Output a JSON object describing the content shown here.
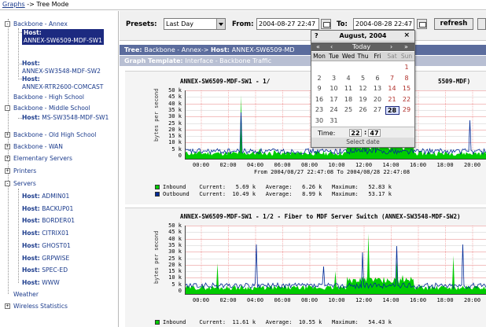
{
  "breadcrumb": {
    "link": "Graphs",
    "sep": " -> ",
    "current": "Tree Mode"
  },
  "tree": {
    "annex": "Backbone - Annex",
    "annex_hosts": [
      {
        "prefix": "Host:",
        "name": "ANNEX-SW6509-MDF-SW1"
      },
      {
        "prefix": "Host:",
        "name": "ANNEX-SW3548-MDF-SW2"
      },
      {
        "prefix": "Host:",
        "name": "ANNEX-RTR2600-COMCAST"
      }
    ],
    "high_school": "Backbone - High School",
    "middle_school": "Backbone - Middle School",
    "middle_host": {
      "prefix": "Host:",
      "name": "MS-SW3548-MDF-SW1"
    },
    "old_high": "Backbone - Old High School",
    "wan": "Backbone - WAN",
    "elementary": "Elementary Servers",
    "printers": "Printers",
    "servers": "Servers",
    "server_hosts": [
      {
        "prefix": "Host:",
        "name": "ADMIN01"
      },
      {
        "prefix": "Host:",
        "name": "BACKUP01"
      },
      {
        "prefix": "Host:",
        "name": "BORDER01"
      },
      {
        "prefix": "Host:",
        "name": "CITRIX01"
      },
      {
        "prefix": "Host:",
        "name": "GHOST01"
      },
      {
        "prefix": "Host:",
        "name": "GRPWISE"
      },
      {
        "prefix": "Host:",
        "name": "SPEC-ED"
      },
      {
        "prefix": "Host:",
        "name": "WWW"
      }
    ],
    "weather": "Weather",
    "wireless": "Wireless Statistics",
    "plus": "+",
    "minus": "-"
  },
  "toolbar": {
    "presets_label": "Presets:",
    "preset_value": "Last Day",
    "from_label": "From:",
    "from_value": "2004-08-27 22:47",
    "to_label": "To:",
    "to_value": "2004-08-28 22:47",
    "refresh": "refresh"
  },
  "treebar": {
    "prefix": "Tree: ",
    "text": "Backbone - Annex-> ",
    "host_label": "Host: ",
    "host": "ANNEX-SW6509-MD"
  },
  "template": {
    "label": "Graph Template: ",
    "value": "Interface - Backbone Traffic"
  },
  "calendar": {
    "help": "?",
    "month": "August, 2004",
    "close": "×",
    "prev_year": "«",
    "prev_month": "‹",
    "today": "Today",
    "next_month": "›",
    "next_year": "»",
    "dow": [
      "Mon",
      "Tue",
      "Wed",
      "Thu",
      "Fri",
      "Sat",
      "Sun"
    ],
    "weeks": [
      [
        "",
        "",
        "",
        "",
        "",
        "",
        "1"
      ],
      [
        "2",
        "3",
        "4",
        "5",
        "6",
        "7",
        "8"
      ],
      [
        "9",
        "10",
        "11",
        "12",
        "13",
        "14",
        "15"
      ],
      [
        "16",
        "17",
        "18",
        "19",
        "20",
        "21",
        "22"
      ],
      [
        "23",
        "24",
        "25",
        "26",
        "27",
        "28",
        "29"
      ],
      [
        "30",
        "31",
        "",
        "",
        "",
        "",
        ""
      ]
    ],
    "selected": "28",
    "time_label": "Time:",
    "hour": "22",
    "colon": ":",
    "minute": "47",
    "footer": "Select date"
  },
  "graph1": {
    "title": "ANNEX-SW6509-MDF-SW1 - 1/",
    "title_tail": "5509-MDF)",
    "ylabel": "bytes per second",
    "yticks": [
      "50 k",
      "45 k",
      "40 k",
      "35 k",
      "30 k",
      "25 k",
      "20 k",
      "15 k",
      "10 k",
      "5 k",
      "0"
    ],
    "xticks": [
      "00:00",
      "02:00",
      "04:00",
      "06:00",
      "08:00",
      "10:00",
      "12:00",
      "14:00",
      "16:00",
      "18:00",
      "20:00"
    ],
    "fromto": "From 2004/08/27 22:47:08 To 2004/08/28 22:47:08",
    "legend": [
      {
        "name": "Inbound ",
        "current": "5.69 k",
        "average": "6.26 k",
        "maximum": "52.83 k"
      },
      {
        "name": "Outbound",
        "current": "10.49 k",
        "average": "8.99 k",
        "maximum": "53.17 k"
      }
    ]
  },
  "graph2": {
    "title": "ANNEX-SW6509-MDF-SW1 - 1/2 - Fiber to MDF Server Switch (ANNEX-SW3548-MDF-SW2)",
    "ylabel": "bytes per second",
    "yticks": [
      "50 k",
      "45 k",
      "40 k",
      "35 k",
      "30 k",
      "25 k",
      "20 k",
      "15 k",
      "10 k",
      "5 k",
      "0"
    ],
    "xticks": [
      "00:00",
      "02:00",
      "04:00",
      "06:00",
      "08:00",
      "10:00",
      "12:00",
      "14:00",
      "16:00",
      "18:00",
      "20:00"
    ],
    "legend": [
      {
        "name": "Inbound ",
        "current": "11.61 k",
        "average": "10.55 k",
        "maximum": "54.43 k"
      }
    ]
  },
  "legend_labels": {
    "current": "Current:",
    "average": "Average:",
    "maximum": "Maximum:"
  },
  "colors": {
    "inbound": "#00cc00",
    "outbound": "#002a97",
    "selection": "#1c2a80",
    "grid_major": "#f08080"
  }
}
